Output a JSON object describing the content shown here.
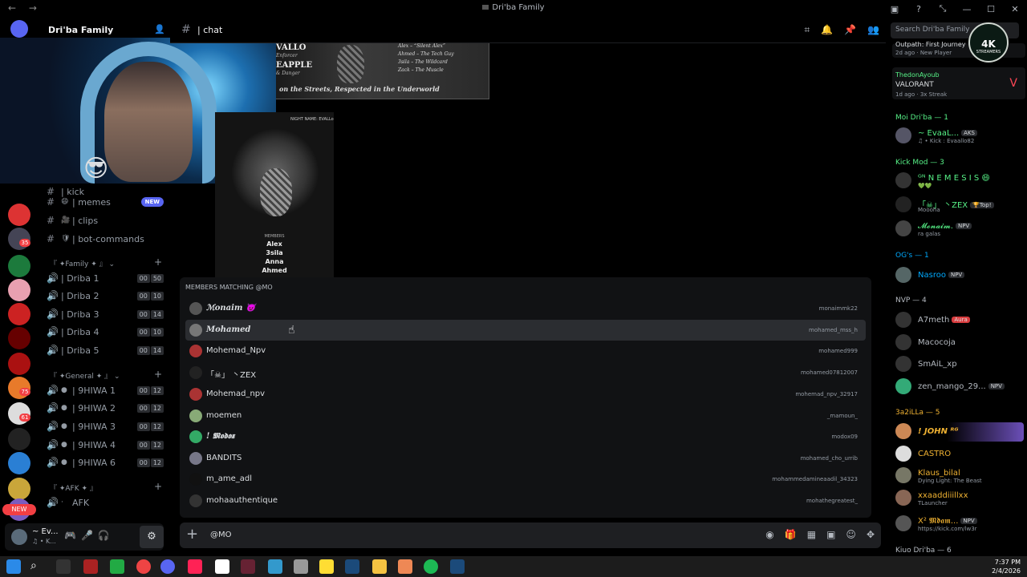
{
  "window": {
    "title": "Dri'ba Family",
    "nav_back": "←",
    "nav_fwd": "→",
    "controls": [
      "▣",
      "?",
      "⤡",
      "—",
      "☐",
      "✕"
    ]
  },
  "server": {
    "name": "Dri'ba Family",
    "rail_badges": [
      "35",
      "75",
      "61"
    ],
    "new_tag": "NEW"
  },
  "channels": {
    "partial_top": "| kick",
    "text": [
      {
        "icon": "😄",
        "label": "| memes",
        "badge": "NEW"
      },
      {
        "icon": "🎥",
        "label": "| clips"
      },
      {
        "icon": "🛡",
        "label": "| bot-commands"
      }
    ],
    "family_category": "『 ✦Family ✦ 』",
    "family_voice": [
      {
        "label": "| Driba 1",
        "a": "00",
        "b": "50"
      },
      {
        "label": "| Driba 2",
        "a": "00",
        "b": "10"
      },
      {
        "label": "| Driba 3",
        "a": "00",
        "b": "14"
      },
      {
        "label": "| Driba 4",
        "a": "00",
        "b": "10"
      },
      {
        "label": "| Driba 5",
        "a": "00",
        "b": "14"
      }
    ],
    "general_category": "『 ✦General ✦ 』",
    "general_voice": [
      {
        "label": "| 9HIWA 1",
        "a": "00",
        "b": "12"
      },
      {
        "label": "| 9HIWA 2",
        "a": "00",
        "b": "12"
      },
      {
        "label": "| 9HIWA 3",
        "a": "00",
        "b": "12"
      },
      {
        "label": "| 9HIWA 4",
        "a": "00",
        "b": "12"
      },
      {
        "label": "| 9HIWA 6",
        "a": "00",
        "b": "12"
      }
    ],
    "afk_category": "『 ✦AFK ✦ 』",
    "afk_channel": "AFK"
  },
  "user_panel": {
    "name": "~ Ev...",
    "status": "♫ • K...",
    "gear": "⚙"
  },
  "chat_header": {
    "hash": "#",
    "channel": "| chat",
    "search_placeholder": "Search Dri'ba Family"
  },
  "poster1": {
    "lines": [
      "VALLO",
      "EAPPLE"
    ],
    "subs": [
      "Enforcer",
      "& Danger"
    ],
    "roster": [
      "Alex – “Silent Alex”",
      "Ahmed – The Tech Guy",
      "3sila – The Wildcard",
      "Zack – The Muscle"
    ],
    "tagline": "on the Streets, Respected in the Underworld"
  },
  "poster2": {
    "header": "NIGHT NAME: EVALLo",
    "members_header": "MEMBERS",
    "members": [
      "Alex",
      "3sila",
      "Anna",
      "Ahmed"
    ]
  },
  "autocomplete": {
    "header": "MEMBERS MATCHING @MO",
    "rows": [
      {
        "name": "ℳonaim 😈",
        "user": "monaimmk22",
        "fancy": true
      },
      {
        "name": "𝑴𝒐𝒉𝒂𝒎𝒆𝒅",
        "user": "mohamed_mss_h",
        "fancy": true,
        "selected": true
      },
      {
        "name": "Mohemad_Npv",
        "user": "mohamed999"
      },
      {
        "name": "「☠」 丶ZEX",
        "user": "mohamed07812007"
      },
      {
        "name": "Mohemad_npv",
        "user": "mohemad_npv_32917"
      },
      {
        "name": "moemen",
        "user": "_mamoun_"
      },
      {
        "name": "! 𝕸𝖔𝖉𝖔𝖝",
        "user": "modox09"
      },
      {
        "name": "BANDITS",
        "user": "mohamed_cho_urrib"
      },
      {
        "name": "m_ame_adl",
        "user": "mohammedamineaadil_34323"
      },
      {
        "name": "mohaauthentique",
        "user": "mohathegreatest_"
      }
    ]
  },
  "message_input": {
    "plus": "+",
    "value": "@MO"
  },
  "member_list": {
    "activity1": {
      "line1": "Outpath: First Journey",
      "line2": "2d ago · New Player"
    },
    "activity2": {
      "user": "ThedonAyoub",
      "game": "VALORANT",
      "line3": "1d ago · 3x Streak"
    },
    "groups": [
      {
        "label": "Moi Dri'ba — 1",
        "color": "#57f287"
      },
      {
        "label": "Kick Mod — 3",
        "color": "#57f287"
      },
      {
        "label": "OG's — 1",
        "color": "#00a8fc"
      },
      {
        "label": "NVP — 4",
        "color": "#b5bac1"
      },
      {
        "label": "3a2iLLa — 5",
        "color": "#f0b232"
      },
      {
        "label": "Kiuo Dri'ba — 6",
        "color": "#b5bac1"
      }
    ],
    "members": [
      {
        "name": "~ EvaaL...",
        "sub": "♫ • Kick : Evaallo82",
        "tag": "AKS",
        "color": "#57f287"
      },
      {
        "name": "ᴳᴺ N E M E S I S 😄",
        "sub": "💚💚",
        "color": "#57f287"
      },
      {
        "name": "「☠」 丶ZEX",
        "sub": "Moooha",
        "tag": "🏆Top!",
        "color": "#57f287"
      },
      {
        "name": "𝓜𝓸𝓷𝓪𝓲𝓶.",
        "sub": "ra galas",
        "tag": "NPV",
        "color": "#57f287"
      },
      {
        "name": "Nasroo",
        "tag": "NPV",
        "color": "#00a8fc"
      },
      {
        "name": "A7meth",
        "tag": "Aura",
        "color": "#b5bac1"
      },
      {
        "name": "Macocoja",
        "color": "#b5bac1"
      },
      {
        "name": "SmAiL_xp",
        "color": "#b5bac1"
      },
      {
        "name": "zen_mango_29...",
        "tag": "NPV",
        "color": "#b5bac1"
      },
      {
        "name": "! JOHN ᴿᴳ",
        "color": "#f0b232"
      },
      {
        "name": "CASTRO",
        "color": "#f0b232"
      },
      {
        "name": "Klaus_bilal",
        "sub": "Dying Light: The Beast",
        "color": "#f0b232"
      },
      {
        "name": "xxaaddiiillxx",
        "sub": "TLauncher",
        "color": "#f0b232"
      },
      {
        "name": "X² 𝕸𝖉𝖆𝖒...",
        "sub": "https://kick.com/lw3r",
        "tag": "NPV",
        "color": "#f0b232"
      }
    ]
  },
  "logo": {
    "text": "4K",
    "sub": "STREAMERS"
  },
  "taskbar": {
    "time": "7:37 PM",
    "date": "2/4/2026"
  }
}
